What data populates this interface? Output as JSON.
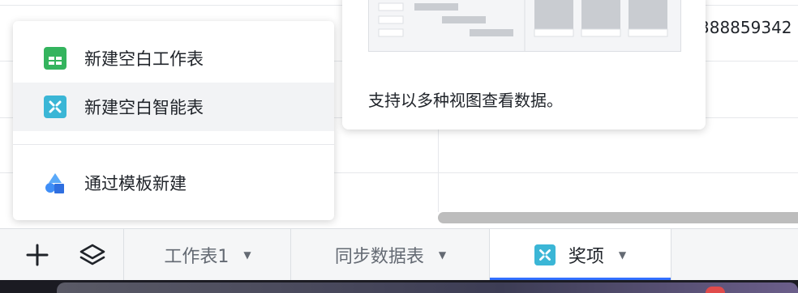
{
  "sheet": {
    "visible_cell_text": "388859342"
  },
  "menu": {
    "items": [
      {
        "label": "新建空白工作表",
        "icon": "sheet-icon"
      },
      {
        "label": "新建空白智能表",
        "icon": "smart-table-icon"
      },
      {
        "label": "通过模板新建",
        "icon": "template-icon"
      }
    ]
  },
  "preview": {
    "description": "支持以多种视图查看数据。"
  },
  "tabbar": {
    "add_icon": "plus-icon",
    "layers_icon": "layers-icon",
    "tabs": [
      {
        "label": "工作表1",
        "active": false
      },
      {
        "label": "同步数据表",
        "active": false
      },
      {
        "label": "奖项",
        "active": true
      }
    ]
  },
  "colors": {
    "accent": "#3370ff",
    "sheet_icon": "#34b45e",
    "smart_table_icon": "#3bb6d6",
    "template_icon": "#3f8ef7"
  }
}
